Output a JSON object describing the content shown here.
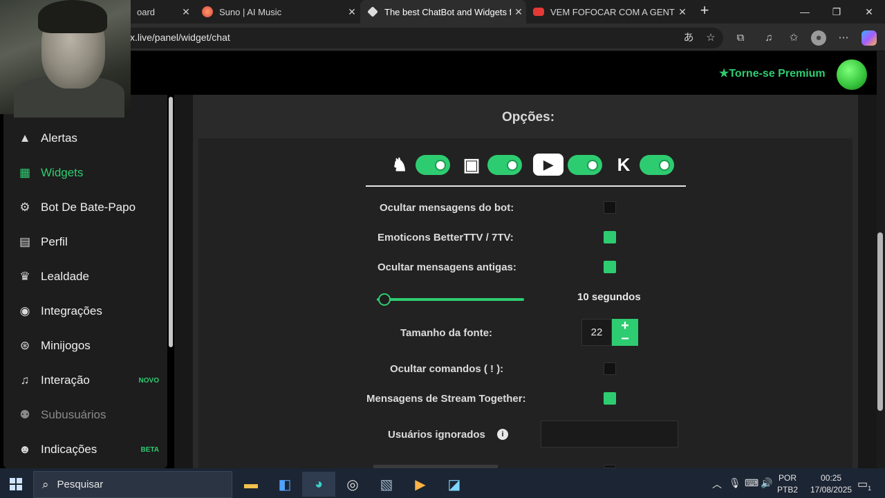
{
  "browser": {
    "tabs": [
      {
        "title": "oard",
        "icon": "dashboard-tab-icon"
      },
      {
        "title": "Suno | AI Music",
        "icon": "suno-icon"
      },
      {
        "title": "The best ChatBot and Widgets fo",
        "icon": "botrix-icon",
        "active": true
      },
      {
        "title": "VEM FOFOCAR COM A GENTE! - Y",
        "icon": "youtube-icon"
      }
    ],
    "url": "x.live/panel/widget/chat"
  },
  "header": {
    "premium_label": "Torne-se Premium"
  },
  "sidebar": {
    "items": [
      {
        "label": "Alertas",
        "icon": "warning-icon"
      },
      {
        "label": "Widgets",
        "icon": "grid-icon",
        "active": true
      },
      {
        "label": "Bot De Bate-Papo",
        "icon": "robot-icon"
      },
      {
        "label": "Perfil",
        "icon": "id-card-icon"
      },
      {
        "label": "Lealdade",
        "icon": "trophy-icon"
      },
      {
        "label": "Integrações",
        "icon": "discord-icon"
      },
      {
        "label": "Minijogos",
        "icon": "gamepad-icon"
      },
      {
        "label": "Interação",
        "icon": "music-icon",
        "badge": "NOVO"
      },
      {
        "label": "Subusuários",
        "icon": "users-cog-icon",
        "disabled": true
      },
      {
        "label": "Indicações",
        "icon": "user-friends-icon",
        "badge": "BETA"
      }
    ]
  },
  "options": {
    "title": "Opções:",
    "platforms": [
      {
        "name": "kick-like-icon",
        "enabled": true
      },
      {
        "name": "twitch-icon",
        "enabled": true
      },
      {
        "name": "youtube-icon",
        "enabled": true
      },
      {
        "name": "kick-icon",
        "enabled": true
      }
    ],
    "hide_bot_messages": {
      "label": "Ocultar mensagens do bot:",
      "checked": false
    },
    "emoticons": {
      "label": "Emoticons BetterTTV / 7TV:",
      "checked": true
    },
    "hide_old_messages": {
      "label": "Ocultar mensagens antigas:",
      "checked": true
    },
    "old_message_timeout": {
      "value_label": "10 segundos",
      "value": 10
    },
    "font_size": {
      "label": "Tamanho da fonte:",
      "value": "22"
    },
    "hide_commands": {
      "label": "Ocultar comandos ( ! ):",
      "checked": false
    },
    "stream_together": {
      "label": "Mensagens de Stream Together:",
      "checked": true
    },
    "ignored_users": {
      "label": "Usuários ignorados",
      "value": ""
    }
  },
  "taskbar": {
    "search_placeholder": "Pesquisar",
    "language": "POR",
    "layout": "PTB2",
    "time": "00:25",
    "date": "17/08/2025",
    "notifications": "1"
  },
  "colors": {
    "accent": "#2ecc71",
    "page_bg": "#222222",
    "sidebar_bg": "#1d1d1d"
  }
}
